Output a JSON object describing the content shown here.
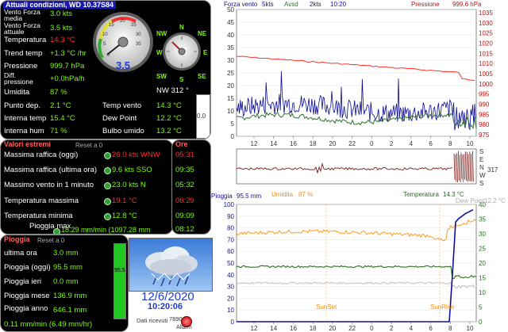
{
  "current": {
    "title": "Attuali condizioni, WD 10.37S84",
    "rows": [
      {
        "label": "Vento Forza media",
        "value": "3.0 kts"
      },
      {
        "label": "Vento Forza attuale",
        "value": "3.5 kts"
      },
      {
        "label": "Temperatura",
        "value": "14.3 °C"
      },
      {
        "label": "Trend temp",
        "value": "+1.3 °C /hr"
      },
      {
        "label": "Pressione",
        "value": "999.7 hPa"
      },
      {
        "label": "Diff. pressione",
        "value": "+0.0hPa/h"
      },
      {
        "label": "Umidita",
        "value": "87 %"
      },
      {
        "label": "Punto dep.",
        "value": "2.1 °C"
      },
      {
        "label": "Interna temp",
        "value": "15.4 °C"
      },
      {
        "label": "Interna hum",
        "value": "71 %"
      }
    ],
    "right_rows": [
      {
        "label": "Temp vento",
        "value": "14.3 °C"
      },
      {
        "label": "Dew Point",
        "value": "12.2 °C"
      },
      {
        "label": "Bulbo umido",
        "value": "13.2 °C"
      }
    ],
    "gauge_value": "3.5",
    "gauge_ticks": [
      "0",
      "5",
      "10",
      "15",
      "20",
      "25",
      "30",
      "35"
    ],
    "compass": {
      "N": "N",
      "S": "S",
      "E": "E",
      "W": "W",
      "NE": "NE",
      "NW": "NW",
      "SE": "SE",
      "SW": "SW"
    },
    "wind_dir": "NW  312 °",
    "side_value": "0.0"
  },
  "extremes": {
    "title": "Valori estremi",
    "reset": "Reset a 0",
    "ore_title": "Ore",
    "rows": [
      {
        "label": "Massima raffica (oggi)",
        "value": "26.0 kts WNW",
        "time": "05:31",
        "red": true
      },
      {
        "label": "Massima raffica (ultima ora)",
        "value": "9.6 kts SSO",
        "time": "09:35",
        "red": false
      },
      {
        "label": "Massimo vento in 1 minuto",
        "value": "23.0 kts    N",
        "time": "05:32",
        "red": false
      },
      {
        "label": "Temperatura massima",
        "value": "19.1 °C",
        "time": "06:29",
        "red": true
      },
      {
        "label": "Temperatura minima",
        "value": "12.8 °C",
        "time": "09:09",
        "red": false
      },
      {
        "label": "Pioggia max",
        "value": "18.29 mm/min (1097.28 mm",
        "time": "08:12",
        "red": false
      }
    ]
  },
  "rain": {
    "title": "Pioggia",
    "reset": "Reset a 0",
    "rows": [
      {
        "label": "ultima ora",
        "value": "3.0 mm"
      },
      {
        "label": "Pioggia (oggi)",
        "value": "95.5 mm"
      },
      {
        "label": "Pioggia ieri",
        "value": "0.0 mm"
      },
      {
        "label": "Pioggia mese",
        "value": "136.9 mm"
      },
      {
        "label": "Pioggia anno",
        "value": "646.1 mm"
      }
    ],
    "rate": "0.11 mm/min (6.49 mm/hr)",
    "bar_value": "95.5",
    "bar_fill": 1.0
  },
  "status": {
    "date": "12/6/2020",
    "time": "10:20:06",
    "received_label": "Dati ricevuti",
    "received_count": "7890",
    "alarm_label": "Allarm"
  },
  "wind_chart": {
    "legend_left": "Forza vento",
    "legend_kts": "5kts",
    "legend_avg_label": "Avsd",
    "legend_avg_kts": "2kts",
    "legend_time": "10:20",
    "legend_press": "Pressione",
    "legend_press_val": "999.6 hPa",
    "left_ticks": [
      "50",
      "45",
      "40",
      "35",
      "30",
      "25",
      "20",
      "15",
      "10",
      "5",
      "0"
    ],
    "right_ticks": [
      "1035",
      "1030",
      "1025",
      "1020",
      "1015",
      "1010",
      "1005",
      "1000",
      "995",
      "990",
      "985",
      "980",
      "975"
    ],
    "x_ticks": [
      "12",
      "14",
      "16",
      "18",
      "20",
      "22",
      "0",
      "2",
      "4",
      "6",
      "8",
      "10"
    ]
  },
  "dir_chart": {
    "labels": [
      "S",
      "E",
      "N",
      "W",
      "S"
    ],
    "value": "317"
  },
  "rain_chart": {
    "legend_rain": "Pioggia",
    "legend_rain_val": "95.5 mm",
    "legend_hum": "Umidita",
    "legend_hum_val": "87 %",
    "legend_temp": "Temperatura",
    "legend_temp_val": "14.3 °C",
    "legend_dew": "Dew Point",
    "legend_dew_val": "12.2 °C",
    "left_ticks": [
      "100",
      "90",
      "80",
      "70",
      "60",
      "50",
      "40",
      "30",
      "20",
      "10",
      "0"
    ],
    "right_ticks": [
      "40",
      "35",
      "30",
      "25",
      "20",
      "15",
      "10",
      "5",
      "0"
    ],
    "x_ticks": [
      "12",
      "14",
      "16",
      "18",
      "20",
      "22",
      "0",
      "2",
      "4",
      "6",
      "8",
      "10"
    ],
    "sunset": "SunSet",
    "sunrise": "SunRise"
  },
  "colors": {
    "wind": "#0a0a96",
    "avg": "#2f6f2f",
    "pressure": "#ff3030",
    "humidity": "#ff9a20",
    "temp": "#3a7a2a",
    "dew": "#c8c8c8",
    "rain": "#1010a0"
  }
}
